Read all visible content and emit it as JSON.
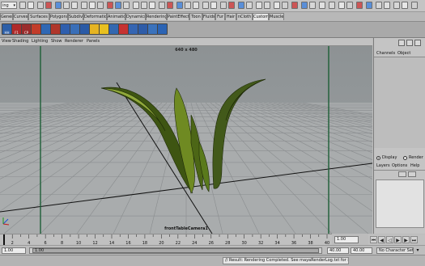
{
  "status_line": {
    "mode_selector_value": "ing"
  },
  "shelf_tabs": [
    {
      "label": "General"
    },
    {
      "label": "Curves"
    },
    {
      "label": "Surfaces"
    },
    {
      "label": "Polygons"
    },
    {
      "label": "Subdivs"
    },
    {
      "label": "Deformation"
    },
    {
      "label": "Animation"
    },
    {
      "label": "Dynamics"
    },
    {
      "label": "Rendering"
    },
    {
      "label": "PaintEffects"
    },
    {
      "label": "Toon"
    },
    {
      "label": "Fluids"
    },
    {
      "label": "Fur"
    },
    {
      "label": "Hair"
    },
    {
      "label": "nCloth"
    },
    {
      "label": "Custom"
    },
    {
      "label": "Muscle"
    }
  ],
  "active_shelf_tab": "Custom",
  "shelf_icons": [
    {
      "icon": "hair-shelf-icon",
      "caption": "HH",
      "color": "#2d5fa8"
    },
    {
      "icon": "follicle-shelf-icon",
      "caption": "F1",
      "color": "#b02a2a"
    },
    {
      "icon": "curve-point-shelf-icon",
      "caption": "CP",
      "color": "#9a2c2c"
    },
    {
      "icon": "paint-shelf-icon",
      "caption": "",
      "color": "#c23c2a"
    },
    {
      "icon": "cube-shelf-icon",
      "caption": "",
      "color": "#3068b4"
    },
    {
      "icon": "sphere-shelf-icon",
      "caption": "",
      "color": "#b0362a"
    },
    {
      "icon": "mesh-shelf-icon",
      "caption": "",
      "color": "#2f5fae"
    },
    {
      "icon": "curve-shelf-icon",
      "caption": "",
      "color": "#3a6fb8"
    },
    {
      "icon": "lattice-shelf-icon",
      "caption": "",
      "color": "#2a5aa6"
    },
    {
      "icon": "folder-shelf-icon",
      "caption": "",
      "color": "#e6b422"
    },
    {
      "icon": "spot-light-shelf-icon",
      "caption": "",
      "color": "#e8c020"
    },
    {
      "icon": "area-light-shelf-icon",
      "caption": "",
      "color": "#3468b0"
    },
    {
      "icon": "ik-shelf-icon",
      "caption": "",
      "color": "#c63232"
    },
    {
      "icon": "bend-shelf-icon",
      "caption": "",
      "color": "#3565b2"
    },
    {
      "icon": "wave-shelf-icon",
      "caption": "",
      "color": "#2e5ca8"
    },
    {
      "icon": "fur-shelf-icon",
      "caption": "",
      "color": "#3a72bc"
    },
    {
      "icon": "fluid-shelf-icon",
      "caption": "",
      "color": "#2c64b4"
    }
  ],
  "panel_menu": [
    "View",
    "Shading",
    "Lighting",
    "Show",
    "Renderer",
    "Panels"
  ],
  "viewport": {
    "resolution_gate": "640 x 480",
    "camera_name": "frontTableCamera1",
    "colors": {
      "grass_dark": "#3e5512",
      "grass_light": "#8fa83a",
      "gate": "#1d5e36"
    }
  },
  "channel_box": {
    "tabs": [
      "Channels",
      "Object"
    ],
    "layer_modes": [
      {
        "label": "Display",
        "selected": true
      },
      {
        "label": "Render",
        "selected": false
      }
    ],
    "layer_menu": [
      "Layers",
      "Options",
      "Help"
    ]
  },
  "timeline": {
    "ticks": [
      2,
      4,
      6,
      8,
      10,
      12,
      14,
      16,
      18,
      20,
      22,
      24,
      26,
      28,
      30,
      32,
      34,
      36,
      38,
      40
    ],
    "current_time": "1.00"
  },
  "range": {
    "start_time": "1.00",
    "inner_start": "1.00",
    "inner_end": "40.00",
    "end_time": "40.00",
    "character_set": "No Character Set"
  },
  "help_line": "// Result: Rendering Completed. See mayaRenderLog.txt for information."
}
